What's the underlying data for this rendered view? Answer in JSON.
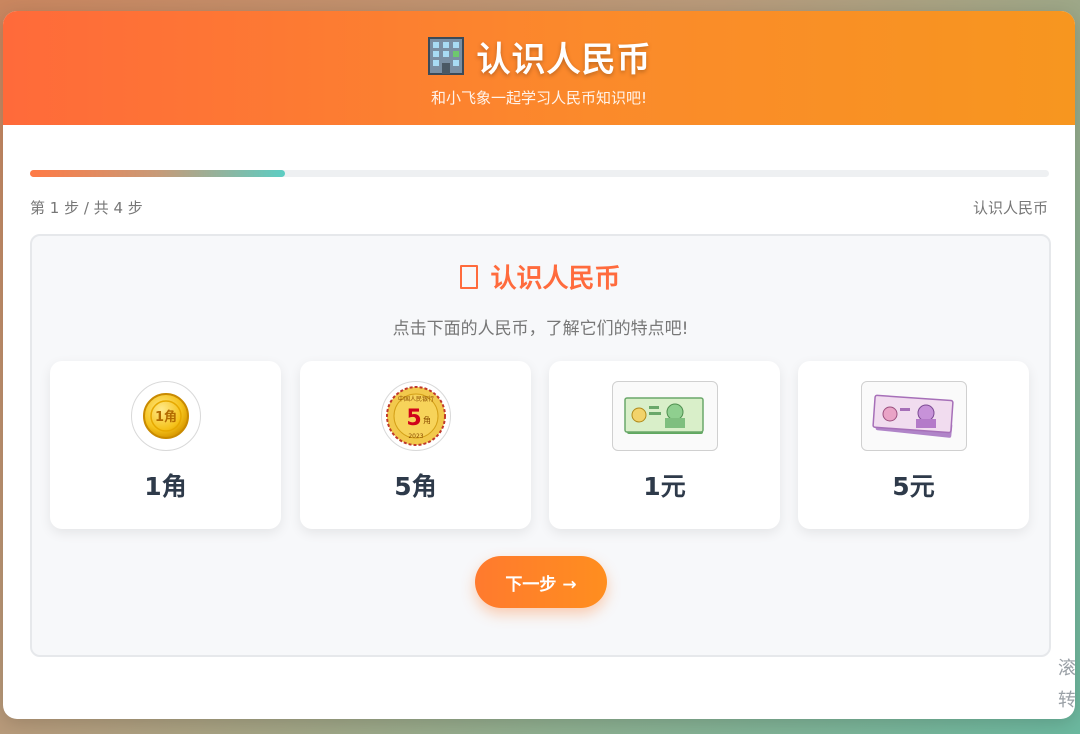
{
  "header": {
    "title": "认识人民币",
    "subtitle": "和小飞象一起学习人民币知识吧!",
    "icon": "building-icon"
  },
  "progress": {
    "value": 0.25,
    "step_text": "第 1 步 / 共 4 步",
    "step_name": "认识人民币"
  },
  "panel": {
    "title": "认识人民币",
    "title_icon": "missing-glyph-icon",
    "description": "点击下面的人民币，了解它们的特点吧!",
    "items": [
      {
        "label": "1角",
        "icon": "coin-1-jiao-icon"
      },
      {
        "label": "5角",
        "icon": "coin-5-jiao-icon"
      },
      {
        "label": "1元",
        "icon": "banknote-1-yuan-icon"
      },
      {
        "label": "5元",
        "icon": "banknote-5-yuan-icon"
      }
    ],
    "next_button": "下一步 →"
  },
  "side_text": [
    "滚",
    "转"
  ],
  "colors": {
    "accent": "#ff6b3d",
    "header_start": "#ff6a3a",
    "header_end": "#f7961f",
    "progress_teal": "#5ccdc3",
    "label_dark": "#2e3a4a"
  }
}
